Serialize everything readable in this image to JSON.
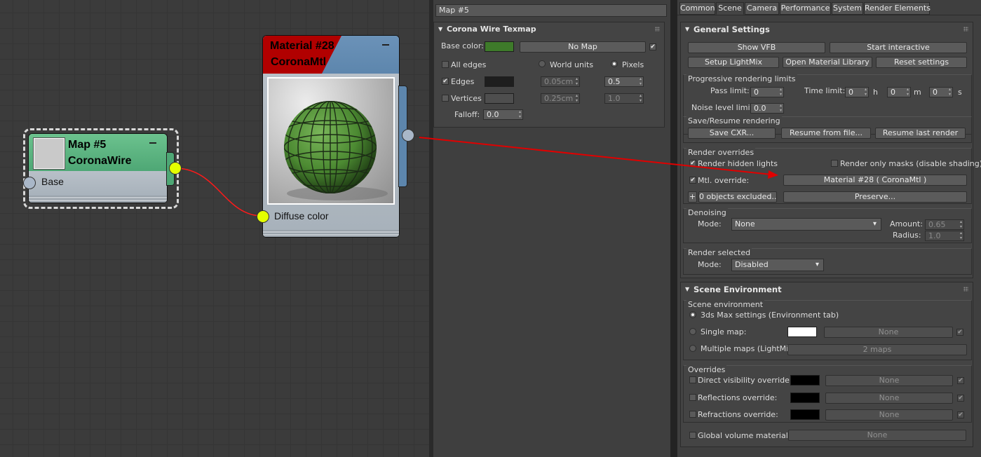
{
  "node_editor": {
    "map_node": {
      "title": "Map #5",
      "subtitle": "CoronaWire",
      "socket_label": "Base"
    },
    "material_node": {
      "title": "Material #28",
      "subtitle": "CoronaMtl",
      "socket_label": "Diffuse color"
    }
  },
  "texmap_panel": {
    "name_field": "Map #5",
    "rollout_title": "Corona Wire Texmap",
    "base_color_label": "Base color:",
    "base_color": "#3e7a2a",
    "base_map_button": "No Map",
    "all_edges_label": "All edges",
    "world_units_label": "World units",
    "pixels_label": "Pixels",
    "edges_label": "Edges",
    "edges_color": "#1e1e1e",
    "edges_world_value": "0.05cm",
    "edges_pixel_value": "0.5",
    "vertices_label": "Vertices",
    "vertices_world_value": "0.25cm",
    "vertices_pixel_value": "1.0",
    "falloff_label": "Falloff:",
    "falloff_value": "0.0"
  },
  "render_panel": {
    "tabs": [
      "Common",
      "Scene",
      "Camera",
      "Performance",
      "System",
      "Render Elements"
    ],
    "general_settings": {
      "title": "General Settings",
      "show_vfb": "Show VFB",
      "start_interactive": "Start interactive",
      "setup_lightmix": "Setup LightMix",
      "open_material_library": "Open Material Library",
      "reset_settings": "Reset settings",
      "progressive_title": "Progressive rendering limits",
      "pass_limit_label": "Pass limit:",
      "pass_limit": "0",
      "time_limit_label": "Time limit:",
      "time_h": "0",
      "h": "h",
      "time_m": "0",
      "m": "m",
      "time_s": "0",
      "s": "s",
      "noise_limit_label": "Noise level limit:",
      "noise_limit": "0.0",
      "save_resume_title": "Save/Resume rendering",
      "save_cxr": "Save CXR...",
      "resume_from_file": "Resume from file...",
      "resume_last": "Resume last render",
      "overrides_title": "Render overrides",
      "render_hidden_lights": "Render hidden lights",
      "render_only_masks": "Render only masks (disable shading)",
      "mtl_override_label": "Mtl. override:",
      "mtl_override_button": "Material #28  ( CoronaMtl )",
      "plus": "+",
      "objects_excluded": "0 objects excluded...",
      "preserve": "Preserve...",
      "denoising_title": "Denoising",
      "denoise_mode_label": "Mode:",
      "denoise_mode": "None",
      "amount_label": "Amount:",
      "amount": "0.65",
      "radius_label": "Radius:",
      "radius": "1.0",
      "render_selected_title": "Render selected",
      "render_selected_mode_label": "Mode:",
      "render_selected_mode": "Disabled"
    },
    "scene_environment": {
      "title": "Scene Environment",
      "group_title": "Scene environment",
      "opt_3dsmax": "3ds Max settings (Environment tab)",
      "opt_single": "Single map:",
      "single_color": "#ffffff",
      "single_map_button": "None",
      "opt_multiple": "Multiple maps (LightMix):",
      "multiple_button": "2 maps",
      "overrides_title": "Overrides",
      "direct_visibility": "Direct visibility override:",
      "reflections": "Reflections override:",
      "refractions": "Refractions override:",
      "override_color": "#000000",
      "none": "None",
      "global_volume": "Global volume material:"
    }
  }
}
